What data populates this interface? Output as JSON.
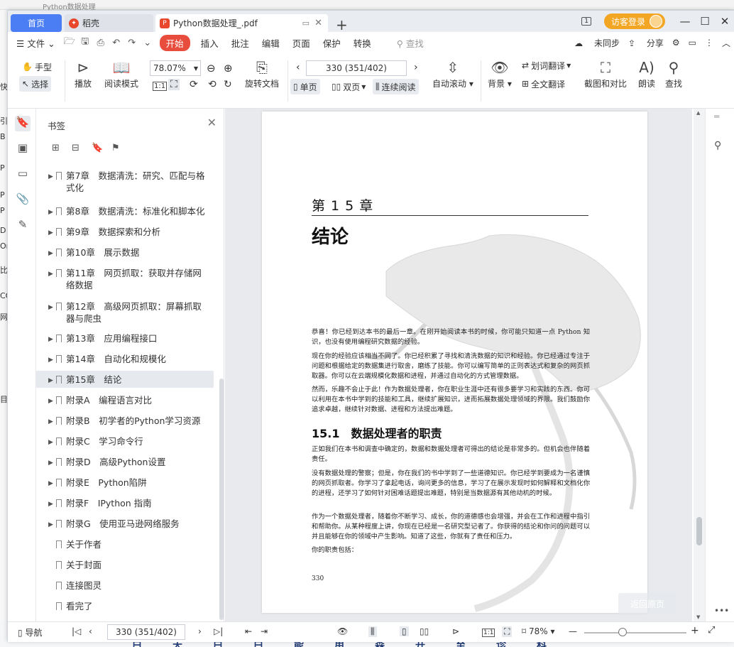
{
  "behind": {
    "top_title": "Python数据处理",
    "left_chars": [
      "快",
      "引",
      "B",
      "P",
      "P",
      "P",
      "D",
      "Or",
      "比",
      "CO",
      "网",
      "目"
    ],
    "bottom_chars": [
      "白",
      "天",
      "白",
      "白",
      "能",
      "用",
      "森",
      "开",
      "至",
      "诊",
      "科"
    ]
  },
  "tabs": {
    "home": "首页",
    "daoke": "稻壳",
    "pdf": "Python数据处理_.pdf",
    "add": "+"
  },
  "titlebar": {
    "visitor": "访客登录",
    "count_badge": "1"
  },
  "menu": {
    "file": "文件",
    "start": "开始",
    "items": [
      "插入",
      "批注",
      "编辑",
      "页面",
      "保护",
      "转换"
    ],
    "search": "查找",
    "unsync": "未同步",
    "share": "分享"
  },
  "toolbar": {
    "hand": "手型",
    "select": "选择",
    "play": "播放",
    "read_mode": "阅读模式",
    "zoom": "78.07%",
    "rotate": "旋转文档",
    "page_field": "330 (351/402)",
    "single": "单页",
    "double": "双页",
    "continuous": "连续阅读",
    "auto_scroll": "自动滚动",
    "background": "背景",
    "word_trans": "划词翻译",
    "full_trans": "全文翻译",
    "screenshot": "截图和对比",
    "read_aloud": "朗读",
    "find": "查找",
    "fit_label": "1:1"
  },
  "bookmarks": {
    "title": "书签",
    "items": [
      {
        "label": "第7章　数据清洗：研究、匹配与格式化",
        "expand": true
      },
      {
        "label": "第8章　数据清洗：标准化和脚本化",
        "expand": true
      },
      {
        "label": "第9章　数据探索和分析",
        "expand": true
      },
      {
        "label": "第10章　展示数据",
        "expand": true
      },
      {
        "label": "第11章　网页抓取：获取并存储网络数据",
        "expand": true
      },
      {
        "label": "第12章　高级网页抓取：屏幕抓取器与爬虫",
        "expand": true
      },
      {
        "label": "第13章　应用编程接口",
        "expand": true
      },
      {
        "label": "第14章　自动化和规模化",
        "expand": true
      },
      {
        "label": "第15章　结论",
        "expand": true,
        "selected": true
      },
      {
        "label": "附录A　编程语言对比",
        "expand": true
      },
      {
        "label": "附录B　初学者的Python学习资源",
        "expand": true
      },
      {
        "label": "附录C　学习命令行",
        "expand": true
      },
      {
        "label": "附录D　高级Python设置",
        "expand": true
      },
      {
        "label": "附录E　Python陷阱",
        "expand": true
      },
      {
        "label": "附录F　IPython 指南",
        "expand": true
      },
      {
        "label": "附录G　使用亚马逊网络服务",
        "expand": true
      },
      {
        "label": "关于作者",
        "expand": false
      },
      {
        "label": "关于封面",
        "expand": false
      },
      {
        "label": "连接图灵",
        "expand": false
      },
      {
        "label": "看完了",
        "expand": false
      }
    ]
  },
  "page": {
    "chapter": "第 1 5 章",
    "title": "结论",
    "p1": "恭喜！你已经到达本书的最后一章。在刚开始阅读本书的时候，你可能只知道一点 Python 知识，也没有使用编程研究数据的经验。",
    "p2": "现在你的经验应该相当不同了。你已经积累了寻找和清洗数据的知识和经验。你已经通过专注于问题和根据给定的数据集进行取舍，磨练了技能。你可以编写简单的正则表达式和复杂的网页抓取器。你可以在云端规模化数据和进程，并通过自动化的方式管理数据。",
    "p3": "然而，乐趣不会止于此！作为数据处理者，你在职业生涯中还有很多要学习和实践的东西。你可以利用在本书中学到的技能和工具，继续扩展知识，进而拓展数据处理领域的界限。我们鼓励你追求卓越，继续针对数据、进程和方法提出难题。",
    "section": "15.1　数据处理者的职责",
    "p4": "正如我们在本书和调查中确定的，数据和数据处理者可得出的结论是非常多的。但机会也伴随着责任。",
    "p5": "没有数据处理的警察；但是，你在我们的书中学到了一些道德知识。你已经学到要成为一名谨慎的网页抓取者。你学习了拿起电话，询问更多的信息，学习了在展示发现时如何解释和文档化你的进程，还学习了如何针对困难话题提出难题，特别是当数据源有其他动机的时候。",
    "p6": "作为一个数据处理者，随着你不断学习、成长，你的道德感也会增强，并会在工作和进程中指引和帮助你。从某种程度上讲，你现在已经是一名研究型记者了。你获得的结论和你问的问题可以并且能够在你的领域中产生影响。知道了这些，你就有了责任和压力。",
    "p7": "你的职责包括：",
    "number": "330"
  },
  "overlay": {
    "back": "返回原页"
  },
  "status": {
    "nav": "导航",
    "page_field": "330 (351/402)",
    "zoom": "78%",
    "fit": "1:1"
  }
}
